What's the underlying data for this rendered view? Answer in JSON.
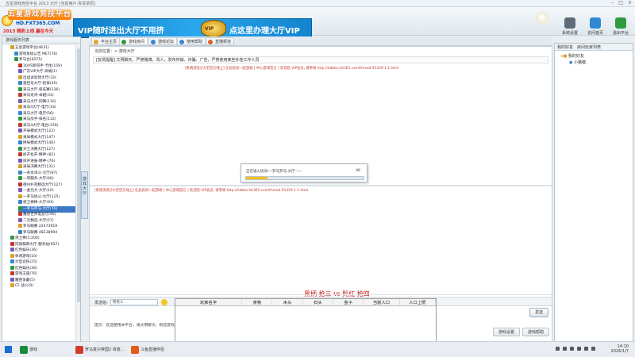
{
  "window": {
    "title": "五星游戏竞技平台 2013 大厅 [当前用户:青青草原]",
    "controls": [
      "–",
      "□",
      "×"
    ]
  },
  "logo": {
    "brand": "五星游戏竞技平台",
    "site": "HD.FXT365.COM",
    "slogan": "2013 精彩上线 赢在今天"
  },
  "banner": {
    "left": "VIP随时进出大厅不用挤",
    "right": "点这里办理大厅VIP",
    "badge": "VIP"
  },
  "header_buttons": [
    {
      "label": "系统设置",
      "color": "#5e6b78"
    },
    {
      "label": "访问首页",
      "color": "#2f89d3"
    },
    {
      "label": "退出平台",
      "color": "#2e9a3e"
    }
  ],
  "sidebar": {
    "title": "游戏服务列表",
    "items": [
      {
        "label": "五星游戏平台(4631)",
        "indent": 2
      },
      {
        "label": "游戏系统公告 MET(76)",
        "indent": 3
      },
      {
        "label": "罗马台(6275)",
        "indent": 3
      },
      {
        "label": "30VS新同手-卡住(159)",
        "indent": 4
      },
      {
        "label": "广东VIP大厅-高端(1)",
        "indent": 4
      },
      {
        "label": "出战试验场大厅(33)",
        "indent": 4
      },
      {
        "label": "遥控号大厅-抢排(45)",
        "indent": 4
      },
      {
        "label": "采马大厅-排名赛(136)",
        "indent": 4
      },
      {
        "label": "采马龙湾-卓越(33)",
        "indent": 4
      },
      {
        "label": "采马大厅-同赛(116)",
        "indent": 4
      },
      {
        "label": "采马4大厅-电厅(33)",
        "indent": 4
      },
      {
        "label": "采马大厅-电厅(56)",
        "indent": 4
      },
      {
        "label": "采马房手-排名(112)",
        "indent": 4
      },
      {
        "label": "采马4大厅-电台(159)",
        "indent": 4
      },
      {
        "label": "开局模式大厅(122)",
        "indent": 4
      },
      {
        "label": "采局模式大厅(147)",
        "indent": 4
      },
      {
        "label": "拼局模式大厅(146)",
        "indent": 4
      },
      {
        "label": "天士决赛大厅(127)",
        "indent": 4
      },
      {
        "label": "拆开拉开-精神-(82)",
        "indent": 4
      },
      {
        "label": "拆开进展-精神-(76)",
        "indent": 4
      },
      {
        "label": "采局决赛大厅(131)",
        "indent": 4
      },
      {
        "label": "一条龙湾斗-大厅(97)",
        "indent": 4
      },
      {
        "label": "一同服务-大厅(90)",
        "indent": 4
      },
      {
        "label": "德州扑克精选大厅(127)",
        "indent": 4
      },
      {
        "label": "一金元大-大厅(10)",
        "indent": 4
      },
      {
        "label": "一罗马协公-大厅(125)",
        "indent": 4
      },
      {
        "label": "保卫棒棒-大厅(93)",
        "indent": 4
      },
      {
        "label": "一罗马罗马-大厅(76)",
        "indent": 4,
        "selected": true
      },
      {
        "label": "魔兽世界电竞厅(95)",
        "indent": 4
      },
      {
        "label": "二元精选-大厅(57)",
        "indent": 4
      },
      {
        "label": "罗马联赛 22473919",
        "indent": 4
      },
      {
        "label": "罗马联赛 48238994",
        "indent": 4
      },
      {
        "label": "保卫棒(5:200)",
        "indent": 2
      },
      {
        "label": "同旗棋牌大厅-服务站(957)",
        "indent": 2
      },
      {
        "label": "红色娱乐(36)",
        "indent": 2
      },
      {
        "label": "休闲游戏(10)",
        "indent": 2
      },
      {
        "label": "大型竞技(25)",
        "indent": 2
      },
      {
        "label": "红色娱乐(36)",
        "indent": 2
      },
      {
        "label": "游戏王座(76)",
        "indent": 2
      },
      {
        "label": "魔兽争霸(5)",
        "indent": 2
      },
      {
        "label": "CF 战火(9)",
        "indent": 2
      }
    ]
  },
  "vertical_tab": "游戏大厅",
  "tabs": [
    {
      "label": "平台主页",
      "color": "#e2a32d"
    },
    {
      "label": "游戏房间",
      "color": "#2e9a3e",
      "active": true
    },
    {
      "label": "游戏论坛",
      "color": "#3a85d0"
    },
    {
      "label": "使用帮助",
      "color": "#3a85d0"
    },
    {
      "label": "直播频道",
      "color": "#e25d2d"
    }
  ],
  "crumb": "当前位置：> 游戏大厅",
  "notice": "[友情提醒] 文明聊天，严禁赌博，骂人，发布传销、诈骗、广告，严禁使用某些外挂工作人员",
  "system_msg": {
    "prefix": "[系统消息]",
    "text": "[大型官方线上] 在此房间一起游戏 [ 中心游戏官方 ] 欢迎您 VIP会员, 请参阅 http://hdbbs.fxt365.com/thread-91429-1-1.html"
  },
  "dialog": {
    "text": "正在进入房间:一罗马罗马-大厅——",
    "pct": "46",
    "progress": 0.18
  },
  "marquee": "黑柄 抢三 vs 髡红 抢四",
  "input": {
    "label": "发送给:",
    "target": "所有人",
    "send": "发送"
  },
  "tips": "提示：欢迎使用本平台，请文明聊天，祝您游戏愉快！",
  "bottom_buttons": [
    "游戏设置",
    "游戏帮助"
  ],
  "score_columns": [
    "玩家名字",
    "食物",
    "木头",
    "石头",
    "金子",
    "当前人口",
    "人口上限"
  ],
  "right_panel": {
    "tabs": [
      "我的好友",
      "房间玩家列表"
    ],
    "items": [
      {
        "label": "我的好友",
        "icon": "folder"
      },
      {
        "label": "小猪猪",
        "icon": "user"
      }
    ]
  },
  "taskbar": {
    "items": [
      {
        "label": "游戏",
        "color": "#1b8b3a"
      },
      {
        "label": "罗马复兴帝国2 百度...",
        "color": "#d23b2b"
      },
      {
        "label": "斗鱼直播伴侣",
        "color": "#e65a18"
      }
    ],
    "time": "14:10",
    "date": "2026/1/7"
  }
}
